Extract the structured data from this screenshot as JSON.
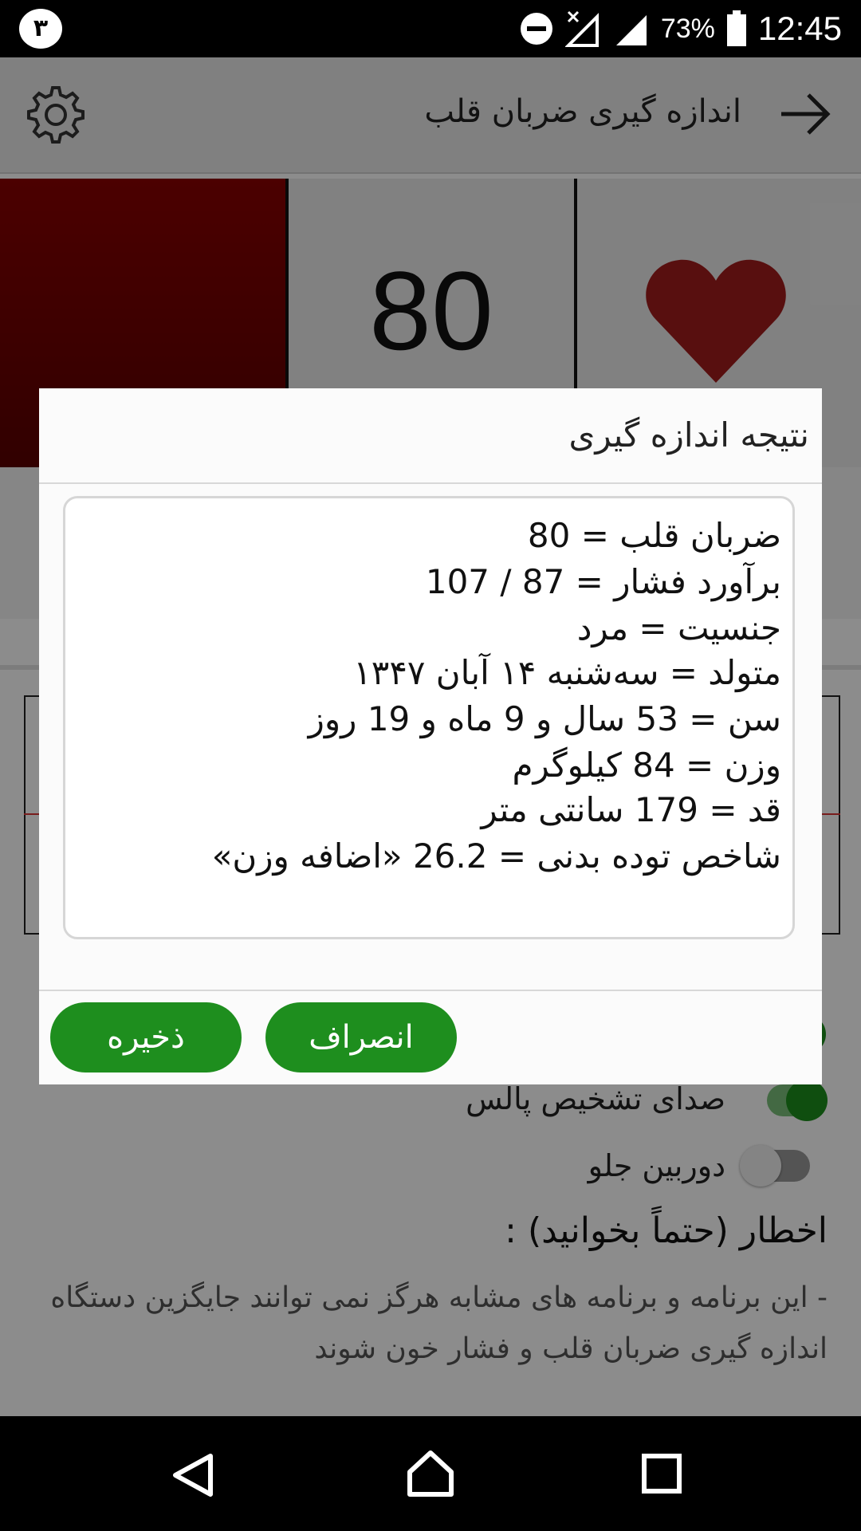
{
  "status_bar": {
    "notification_badge": "٣",
    "battery_percent": "73%",
    "time": "12:45",
    "icons": [
      "dnd-icon",
      "no-signal-icon",
      "signal-icon",
      "battery-icon"
    ]
  },
  "app_bar": {
    "title": "اندازه گیری ضربان قلب",
    "back_icon": "arrow-right-icon",
    "settings_icon": "gear-icon"
  },
  "monitor": {
    "bpm": "80",
    "heart_icon": "heart-icon"
  },
  "settings": {
    "pulse_sound_label": "صدای تشخیص پالس",
    "pulse_sound_on": true,
    "front_camera_label": "دوربین جلو",
    "front_camera_on": false
  },
  "warning": {
    "title": "اخطار (حتماً بخوانید) :",
    "text": "- این برنامه و برنامه های مشابه هرگز نمی توانند جایگزین دستگاه اندازه گیری ضربان قلب و فشار خون شوند"
  },
  "dialog": {
    "title": "نتیجه اندازه گیری",
    "lines": [
      "ضربان قلب = 80",
      "برآورد فشار = 87 / 107",
      "جنسیت = مرد",
      "متولد = سه‌شنبه ۱۴ آبان ۱۳۴۷",
      "سن = 53 سال و 9 ماه و 19 روز",
      "وزن = 84 کیلوگرم",
      "قد = 179 سانتی متر",
      "شاخص توده بدنی = 26.2 «اضافه وزن»"
    ],
    "save_label": "ذخیره",
    "cancel_label": "انصراف"
  },
  "nav_bar": {
    "icons": [
      "back-triangle-icon",
      "home-icon",
      "recents-icon"
    ]
  },
  "colors": {
    "accent_green": "#1e8e1e",
    "heart_red": "#a01c1c",
    "panel_red": "#7a0000"
  }
}
